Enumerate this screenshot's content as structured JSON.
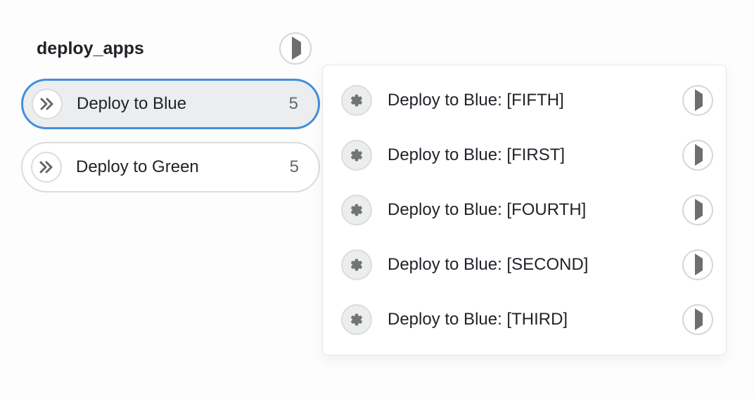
{
  "stage": {
    "title": "deploy_apps",
    "run_icon": "play-icon"
  },
  "jobs": [
    {
      "label": "Deploy to Blue",
      "count": "5",
      "selected": true
    },
    {
      "label": "Deploy to Green",
      "count": "5",
      "selected": false
    }
  ],
  "subjobs": [
    {
      "label": "Deploy to Blue: [FIFTH]"
    },
    {
      "label": "Deploy to Blue: [FIRST]"
    },
    {
      "label": "Deploy to Blue: [FOURTH]"
    },
    {
      "label": "Deploy to Blue: [SECOND]"
    },
    {
      "label": "Deploy to Blue: [THIRD]"
    }
  ]
}
